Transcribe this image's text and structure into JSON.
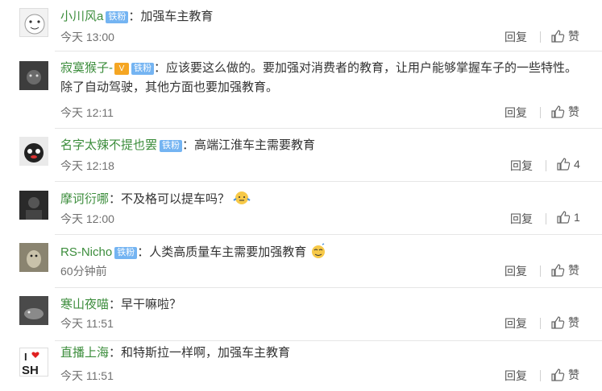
{
  "reply_label": "回复",
  "colors": {
    "username": "#3c8d3c",
    "badge": "#74b4f2",
    "divider": "#e6e6e6"
  },
  "comments": [
    {
      "user": "小川风a",
      "badge": "铁粉",
      "text": "：加强车主教育",
      "time": "今天 13:00",
      "like": "赞"
    },
    {
      "user": "寂寞猴子-",
      "badge": "铁粉",
      "text": "：应该要这么做的。要加强对消费者的教育，让用户能够掌握车子的一些特性。除了自动驾驶，其他方面也要加强教育。",
      "time": "今天 12:11",
      "like": "赞"
    },
    {
      "user": "名字太辣不提也罢",
      "badge": "铁粉",
      "text": "：高端江淮车主需要教育",
      "time": "今天 12:18",
      "like": "4"
    },
    {
      "user": "摩诃衍哪",
      "text": "：不及格可以提车吗？",
      "time": "今天 12:00",
      "like": "1"
    },
    {
      "user": "RS-Nicho",
      "badge": "铁粉",
      "text": "：人类高质量车主需要加强教育",
      "time": "60分钟前",
      "like": "赞"
    },
    {
      "user": "寒山夜喵",
      "text": "：早干嘛啦？",
      "time": "今天 11:51",
      "like": "赞"
    },
    {
      "user": "直播上海",
      "text": "：和特斯拉一样啊，加强车主教育",
      "time": "今天 11:51",
      "like": "赞",
      "avatar_text": [
        "I",
        "SH"
      ]
    }
  ]
}
